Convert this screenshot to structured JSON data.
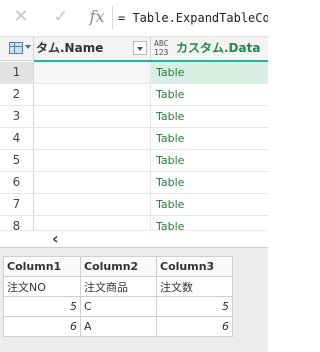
{
  "formula_bar": {
    "cancel_icon": "x-icon",
    "confirm_icon": "check-icon",
    "fx_label": "fx",
    "formula": "= Table.ExpandTableColumn(#\"追加されたカスタム\", \"カスタム\", {\"Data\"}, {\"カスタム.Data\"})"
  },
  "grid": {
    "columns": [
      {
        "label": "タム.Name",
        "type_label_top": "",
        "type_label_bottom": ""
      },
      {
        "label": "カスタム.Data",
        "type_label_top": "ABC",
        "type_label_bottom": "123"
      }
    ],
    "rows": [
      {
        "num": "1",
        "name": "",
        "data": "Table"
      },
      {
        "num": "2",
        "name": "",
        "data": "Table"
      },
      {
        "num": "3",
        "name": "",
        "data": "Table"
      },
      {
        "num": "4",
        "name": "",
        "data": "Table"
      },
      {
        "num": "5",
        "name": "",
        "data": "Table"
      },
      {
        "num": "6",
        "name": "",
        "data": "Table"
      },
      {
        "num": "7",
        "name": "",
        "data": "Table"
      },
      {
        "num": "8",
        "name": "",
        "data": "Table"
      }
    ],
    "selected_row": "1",
    "scroll_left_icon": "chevron-left-icon"
  },
  "preview": {
    "headers": [
      "Column1",
      "Column2",
      "Column3"
    ],
    "rows": [
      [
        "注文NO",
        "注文商品",
        "注文数"
      ],
      [
        "5",
        "C",
        "5"
      ],
      [
        "6",
        "A",
        "6"
      ]
    ]
  },
  "colors": {
    "accent": "#19b99a",
    "selected_cell": "#d8f0e3",
    "table_text": "#2a7b3a"
  }
}
